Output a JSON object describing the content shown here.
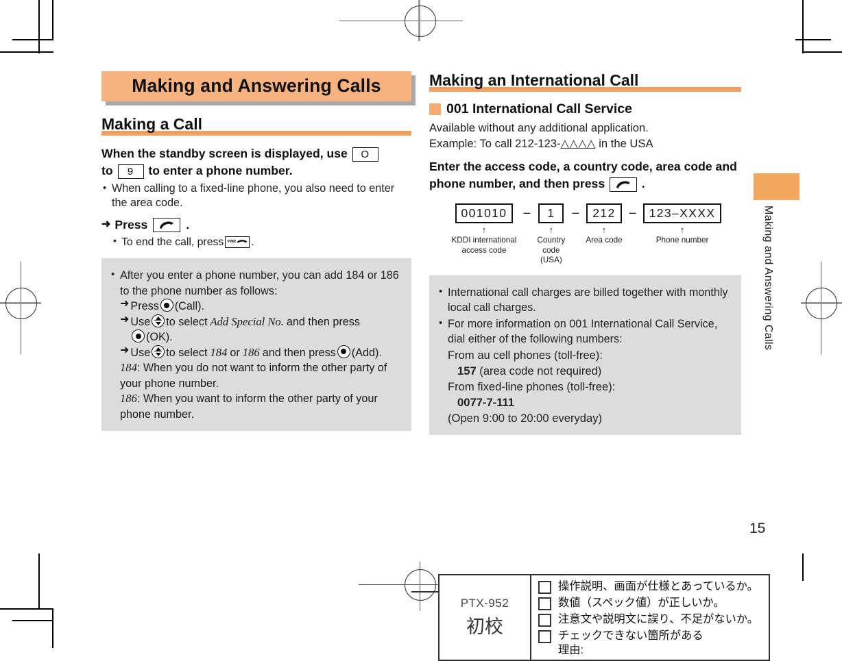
{
  "page": {
    "number": "15",
    "side_tab_label": "Making and Answering Calls"
  },
  "chapter": {
    "title": "Making and Answering Calls"
  },
  "left_column": {
    "section_title": "Making a Call",
    "step1": {
      "part_a": "When the standby screen is displayed, use",
      "key_zero": "O",
      "part_b": "to",
      "key_nine": "9",
      "part_c": "to enter a phone number."
    },
    "step1_bullets": [
      "When calling to a fixed-line phone, you also need to enter the area code."
    ],
    "step2": {
      "arrow": "➜",
      "label": "Press",
      "period": "."
    },
    "step2_bullet": {
      "text": "To end the call, press",
      "key_pwr_label": "PWR",
      "period": "."
    },
    "note_box": {
      "bullet_1": "After you enter a phone number, you can add 184 or 186 to the phone number as follows:",
      "sub_steps": [
        {
          "arrow": "➜",
          "pre": "Press",
          "key": "center",
          "post": "(Call)."
        },
        {
          "arrow": "➜",
          "pre": "Use",
          "key": "updown",
          "mid": "to select",
          "italic": "Add Special No.",
          "post": "and then press"
        },
        {
          "cont_key": "center",
          "cont_post": "(OK)."
        },
        {
          "arrow": "➜",
          "pre": "Use",
          "key": "updown",
          "mid": "to select",
          "italic": "184",
          "mid2": "or",
          "italic2": "186",
          "post2": "and then press",
          "key2": "center",
          "end": "(Add)."
        }
      ],
      "defs": [
        {
          "term": "184",
          "colon": ":",
          "text": "When you do not want to inform the other party of your phone number."
        },
        {
          "term": "186",
          "colon": ":",
          "text": "When you want to inform the other party of your phone number."
        }
      ]
    }
  },
  "right_column": {
    "section_title": "Making an International Call",
    "sub_title": "001 International Call Service",
    "intro_lines": [
      "Available without any additional application.",
      "Example: To call 212-123-△△△△ in the USA"
    ],
    "bold_instruction": {
      "part_a": "Enter the access code, a country code, area code and phone number, and then press",
      "period": "."
    },
    "diagram": {
      "separator": "–",
      "arrow": "↑",
      "parts": [
        {
          "value": "001010",
          "label": "KDDI international\naccess code"
        },
        {
          "value": "1",
          "label": "Country\ncode\n(USA)"
        },
        {
          "value": "212",
          "label": "Area code"
        },
        {
          "value": "123–XXXX",
          "label": "Phone number"
        }
      ]
    },
    "note_box": {
      "bullets": [
        "International call charges are billed together with monthly local call charges.",
        "For more information on 001 International Call Service, dial either of the following numbers:"
      ],
      "lines": [
        {
          "text": "From au cell phones (toll-free):",
          "bold": false,
          "indent": 0
        },
        {
          "text": "157",
          "suffix": " (area code not required)",
          "bold": true,
          "indent": 1
        },
        {
          "text": "From fixed-line phones (toll-free):",
          "bold": false,
          "indent": 0
        },
        {
          "text": "0077-7-111",
          "suffix": "",
          "bold": true,
          "indent": 1
        },
        {
          "text": "(Open 9:00 to 20:00 everyday)",
          "suffix": "",
          "bold": false,
          "indent": 0
        }
      ]
    }
  },
  "proof_stamp": {
    "code": "PTX-952",
    "stage": "初校",
    "checklist": [
      {
        "line1": "操作説明、画面が仕様とあっているか。",
        "line2": ""
      },
      {
        "line1": "数値（スペック値）が正しいか。",
        "line2": ""
      },
      {
        "line1": "注意文や説明文に誤り、不足がないか。",
        "line2": ""
      },
      {
        "line1": "チェックできない箇所がある",
        "line2": "理由:"
      }
    ]
  },
  "colors": {
    "accent_orange": "#f3a65f",
    "chapter_bar": "#f6b27f",
    "note_gray": "#dcdcdc",
    "shadow_gray": "#a9a9a9"
  }
}
